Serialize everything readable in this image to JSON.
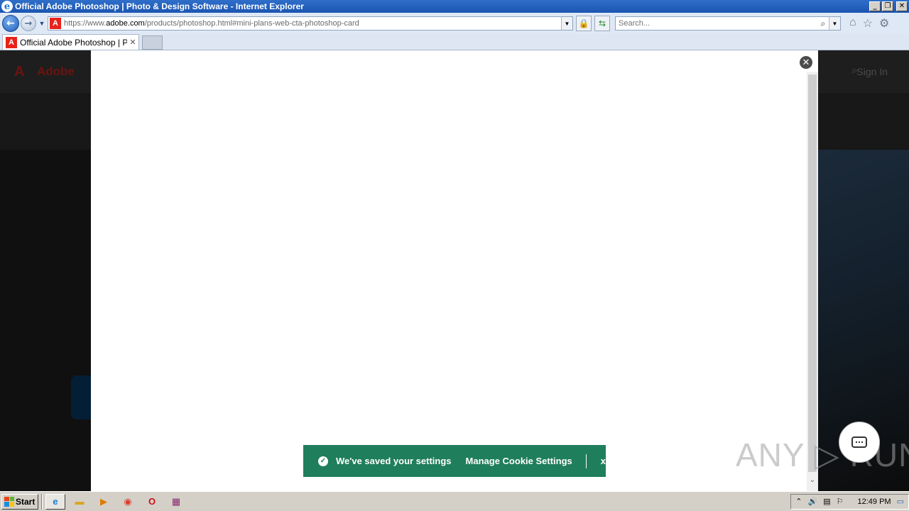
{
  "window": {
    "title": "Official Adobe Photoshop | Photo & Design Software - Internet Explorer",
    "minimize": "_",
    "restore": "❐",
    "close": "✕"
  },
  "navbar": {
    "url_prefix": "https://www.",
    "url_domain": "adobe.com",
    "url_path": "/products/photoshop.html#mini-plans-web-cta-photoshop-card",
    "search_placeholder": "Search..."
  },
  "tab": {
    "label": "Official Adobe Photoshop | P...",
    "close": "✕"
  },
  "page": {
    "brand": "Adobe",
    "signin": "Sign In"
  },
  "toast": {
    "message": "We've saved your settings",
    "link": "Manage Cookie Settings",
    "close": "x"
  },
  "watermark": "ANY ▷ RUN",
  "taskbar": {
    "start": "Start",
    "clock": "12:49 PM"
  },
  "icons": {
    "ie": "e",
    "adobe": "A",
    "back": "←",
    "forward": "→",
    "dropdown": "▼",
    "lock": "🔒",
    "refresh": "⇆",
    "search": "⌕",
    "home": "⌂",
    "star": "☆",
    "gear": "⚙",
    "modal_close": "✕",
    "check": "✓",
    "chevron_down": "⌄"
  },
  "colors": {
    "toast_bg": "#1f7e5b",
    "titlebar": "#1b56b1",
    "adobe_red": "#e8221a"
  }
}
